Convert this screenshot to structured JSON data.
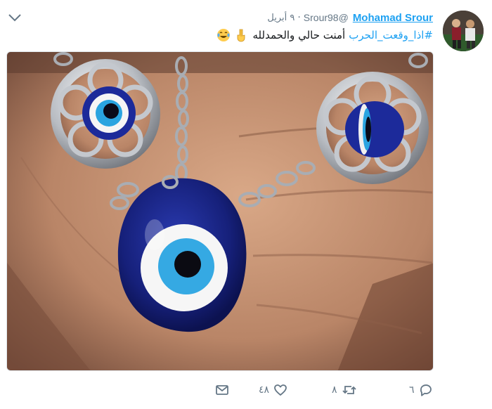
{
  "tweet": {
    "display_name": "Mohamad Srour",
    "handle": "@Srour98",
    "separator": "·",
    "time": "٩ أبريل",
    "hashtag": "#اذا_وقعت_الحرب",
    "body_text": "أمنت حالي والحمدلله",
    "emojis": [
      "point-down-emoji",
      "laughing-tears-emoji"
    ]
  },
  "actions": {
    "reply_count": "٦",
    "retweet_count": "٨",
    "like_count": "٤٨"
  },
  "colors": {
    "link": "#1da1f2",
    "muted": "#657786",
    "text": "#14171a",
    "evil_eye_blue": "#1a2a8c",
    "chain_silver": "#b8bcc2"
  },
  "icons": [
    "chevron-down-icon",
    "reply-icon",
    "retweet-icon",
    "like-icon",
    "message-icon"
  ]
}
